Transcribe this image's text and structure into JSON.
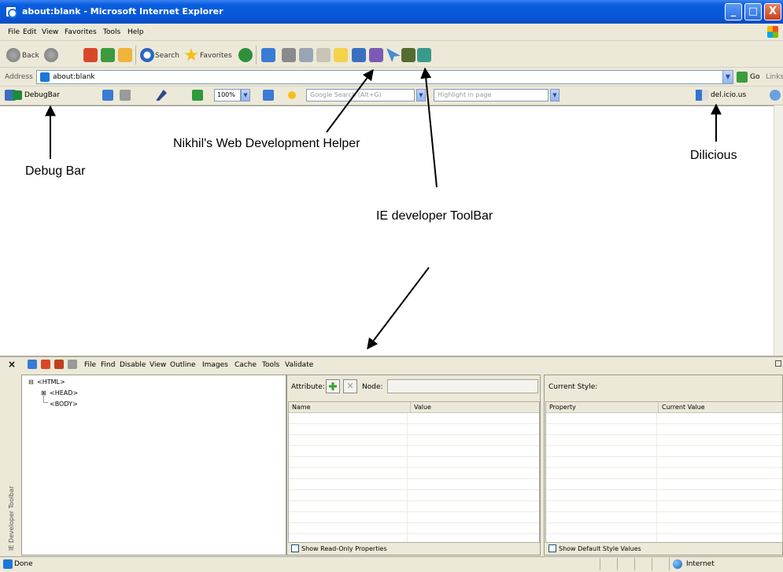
{
  "window": {
    "title": "about:blank - Microsoft Internet Explorer",
    "minimize": "_",
    "maximize": "□",
    "close": "X"
  },
  "menubar": [
    "File",
    "Edit",
    "View",
    "Favorites",
    "Tools",
    "Help"
  ],
  "toolbar": {
    "back": "Back",
    "search": "Search",
    "favorites": "Favorites"
  },
  "address": {
    "label": "Address",
    "value": "about:blank",
    "go": "Go",
    "links": "Links"
  },
  "extensions": {
    "debugbar": "DebugBar",
    "zoom": "100%",
    "google_placeholder": "Google Search (Alt+G)",
    "highlight_placeholder": "Highlight in page",
    "delicious": "del.icio.us"
  },
  "annotations": {
    "nikhil": "Nikhil's Web Development Helper",
    "debugbar": "Debug Bar",
    "dilicious": "Dilicious",
    "ie_toolbar": "IE developer ToolBar"
  },
  "devtoolbar": {
    "close": "×",
    "side_label": "IE Developer Toolbar",
    "menu": [
      "File",
      "Find",
      "Disable",
      "View",
      "Outline",
      "Images",
      "Cache",
      "Tools",
      "Validate"
    ],
    "tree": [
      "<HTML>",
      "<HEAD>",
      "<BODY>"
    ],
    "attribute_label": "Attribute:",
    "node_label": "Node:",
    "attr_columns": [
      "Name",
      "Value"
    ],
    "show_readonly": "Show Read-Only Properties",
    "current_style": "Current Style:",
    "style_columns": [
      "Property",
      "Current Value"
    ],
    "show_default": "Show Default Style Values"
  },
  "status": {
    "text": "Done",
    "zone": "Internet"
  }
}
